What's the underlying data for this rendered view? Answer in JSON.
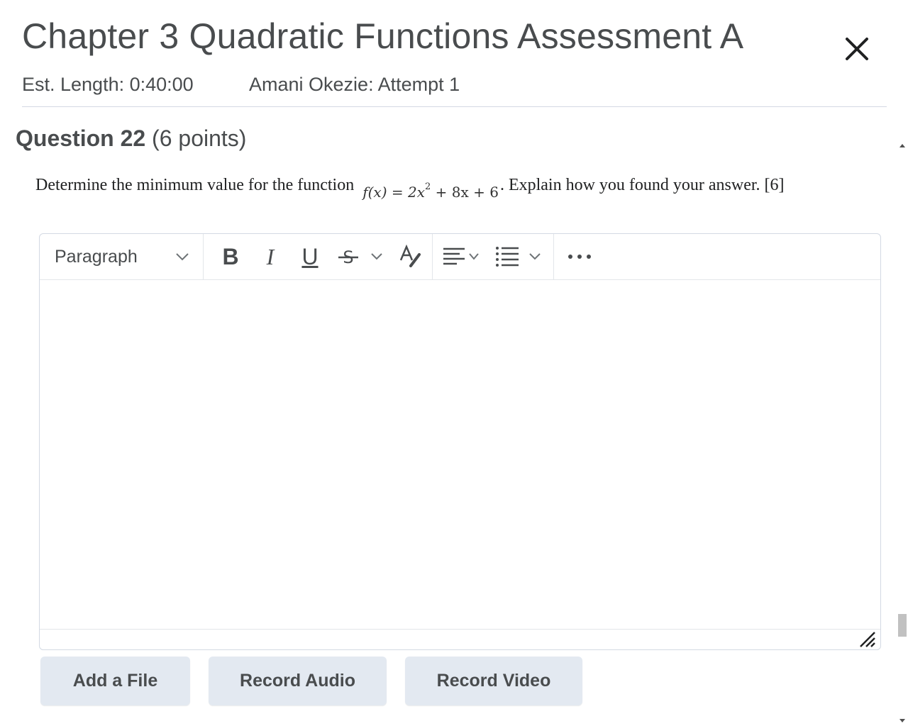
{
  "header": {
    "title": "Chapter 3 Quadratic Functions Assessment A",
    "est_length": "Est. Length: 0:40:00",
    "attempt": "Amani Okezie: Attempt 1",
    "close_icon": "close-icon"
  },
  "question": {
    "number_label": "Question 22",
    "points_label": "(6 points)",
    "prompt_before": "Determine the minimum value for the function ",
    "math_expression": "f(x) = 2x² + 8x + 6",
    "math_lhs": "f(x) = 2x",
    "math_exp": "2",
    "math_rhs": " + 8x + 6",
    "prompt_after": ". Explain how you found your answer. [6]"
  },
  "editor": {
    "format_select": "Paragraph",
    "toolbar_icons": [
      "bold-icon",
      "italic-icon",
      "underline-icon",
      "strikethrough-icon",
      "chevron-down-icon",
      "clear-format-icon",
      "align-left-icon",
      "list-icon",
      "more-icon"
    ],
    "bold_label": "B",
    "italic_label": "I",
    "underline_label": "U",
    "more_label": "•••",
    "content": ""
  },
  "actions": {
    "add_file": "Add a File",
    "record_audio": "Record Audio",
    "record_video": "Record Video"
  },
  "colors": {
    "text": "#494c4e",
    "button_bg": "#e3e9f1",
    "border": "#d3d9e3"
  }
}
